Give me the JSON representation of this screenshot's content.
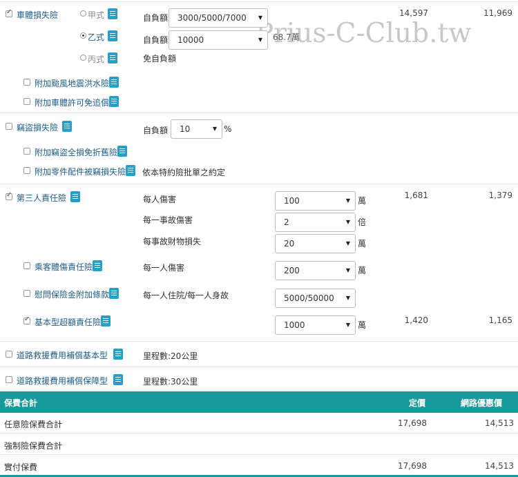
{
  "watermark": "Prius-C-Club.tw",
  "vehicle_damage": {
    "label": "車體損失險",
    "checked": true,
    "plans": [
      {
        "label": "甲式",
        "selected": false
      },
      {
        "label": "乙式",
        "selected": true
      },
      {
        "label": "丙式",
        "selected": false
      }
    ],
    "deductible_label": "自負額",
    "deductible_select": "3000/5000/7000",
    "amount_label": "自負額",
    "amount_select": "10000",
    "amount_suffix": "68.7萬",
    "no_deductible": "免自負額",
    "list_price": "14,597",
    "online_price": "11,969",
    "addons": [
      {
        "label": "附加颱風地震洪水險",
        "checked": false
      },
      {
        "label": "附加車體許可免追償",
        "checked": false
      }
    ]
  },
  "theft": {
    "label": "竊盜損失險",
    "checked": false,
    "deductible_label": "自負額",
    "deductible_select": "10",
    "deductible_unit": "%",
    "addons": [
      {
        "label": "附加竊盜全損免折舊險",
        "checked": false
      },
      {
        "label": "附加零件配件被竊損失險",
        "checked": false,
        "note": "依本特約險批單之約定"
      }
    ]
  },
  "third_party": {
    "label": "第三人責任險",
    "checked": true,
    "rows": [
      {
        "label": "每人傷害",
        "select": "100",
        "unit": "萬"
      },
      {
        "label": "每一事故傷害",
        "select": "2",
        "unit": "倍"
      },
      {
        "label": "每事故財物損失",
        "select": "20",
        "unit": "萬"
      }
    ],
    "list_price": "1,681",
    "online_price": "1,379",
    "passenger": {
      "label": "乘客體傷責任險",
      "checked": false,
      "field_label": "每一人傷害",
      "select": "200",
      "unit": "萬"
    },
    "consolation": {
      "label": "慰問保險金附加條款",
      "checked": false,
      "field_label": "每一人住院/每一人身故",
      "select": "5000/50000"
    },
    "excess": {
      "label": "基本型超額責任險",
      "checked": true,
      "select": "1000",
      "unit": "萬",
      "list_price": "1,420",
      "online_price": "1,165"
    }
  },
  "roadside_basic": {
    "label": "道路救援費用補償基本型",
    "checked": false,
    "mileage": "里程數:20公里"
  },
  "roadside_plus": {
    "label": "道路救援費用補償保障型",
    "checked": false,
    "mileage": "里程數:30公里"
  },
  "summary": {
    "header": "保費合計",
    "col_list": "定價",
    "col_online": "網路優惠價",
    "rows": [
      {
        "label": "任意險保費合計",
        "list": "17,698",
        "online": "14,513"
      },
      {
        "label": "強制險保費合計",
        "list": "",
        "online": ""
      },
      {
        "label": "實付保費",
        "list": "17,698",
        "online": "14,513"
      }
    ]
  },
  "colors": {
    "accent": "#179a99",
    "link": "#1f5e88",
    "doc_icon": "#2a9ec9"
  }
}
